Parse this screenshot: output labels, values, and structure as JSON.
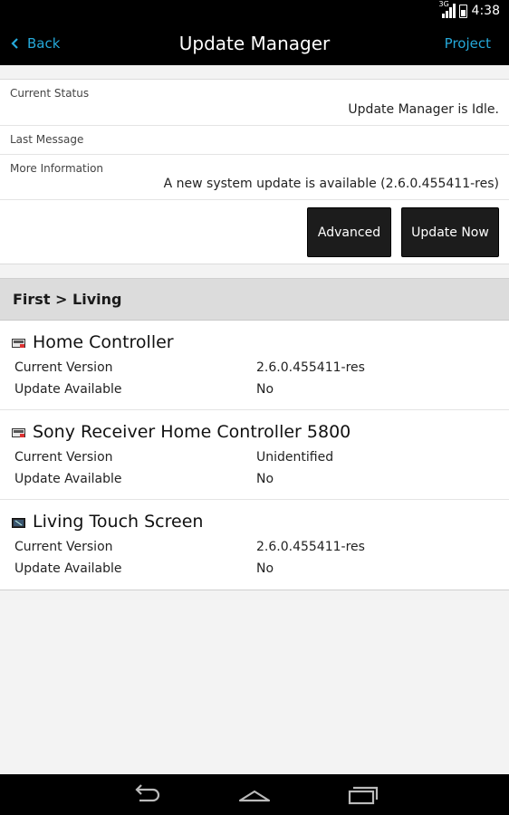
{
  "status_bar": {
    "network_type": "3G",
    "time": "4:38"
  },
  "action_bar": {
    "back_label": "Back",
    "title": "Update Manager",
    "project_label": "Project",
    "accent_color": "#25a8d9"
  },
  "status_panel": {
    "current_status": {
      "label": "Current Status",
      "value": "Update Manager is Idle."
    },
    "last_message": {
      "label": "Last Message",
      "value": ""
    },
    "more_information": {
      "label": "More Information",
      "value": "A new system update is available (2.6.0.455411-res)"
    },
    "advanced_label": "Advanced",
    "update_now_label": "Update Now"
  },
  "section": {
    "title": "First > Living"
  },
  "devices": [
    {
      "icon": "controller-device-icon",
      "name": "Home Controller",
      "current_version_label": "Current Version",
      "current_version": "2.6.0.455411-res",
      "update_available_label": "Update Available",
      "update_available": "No"
    },
    {
      "icon": "receiver-controller-device-icon",
      "name": "Sony Receiver Home Controller 5800",
      "current_version_label": "Current Version",
      "current_version": "Unidentified",
      "update_available_label": "Update Available",
      "update_available": "No"
    },
    {
      "icon": "touch-screen-device-icon",
      "name": "Living Touch Screen",
      "current_version_label": "Current Version",
      "current_version": "2.6.0.455411-res",
      "update_available_label": "Update Available",
      "update_available": "No"
    }
  ],
  "nav_bar": {
    "back_icon": "nav-back-icon",
    "home_icon": "nav-home-icon",
    "recents_icon": "nav-recents-icon"
  }
}
